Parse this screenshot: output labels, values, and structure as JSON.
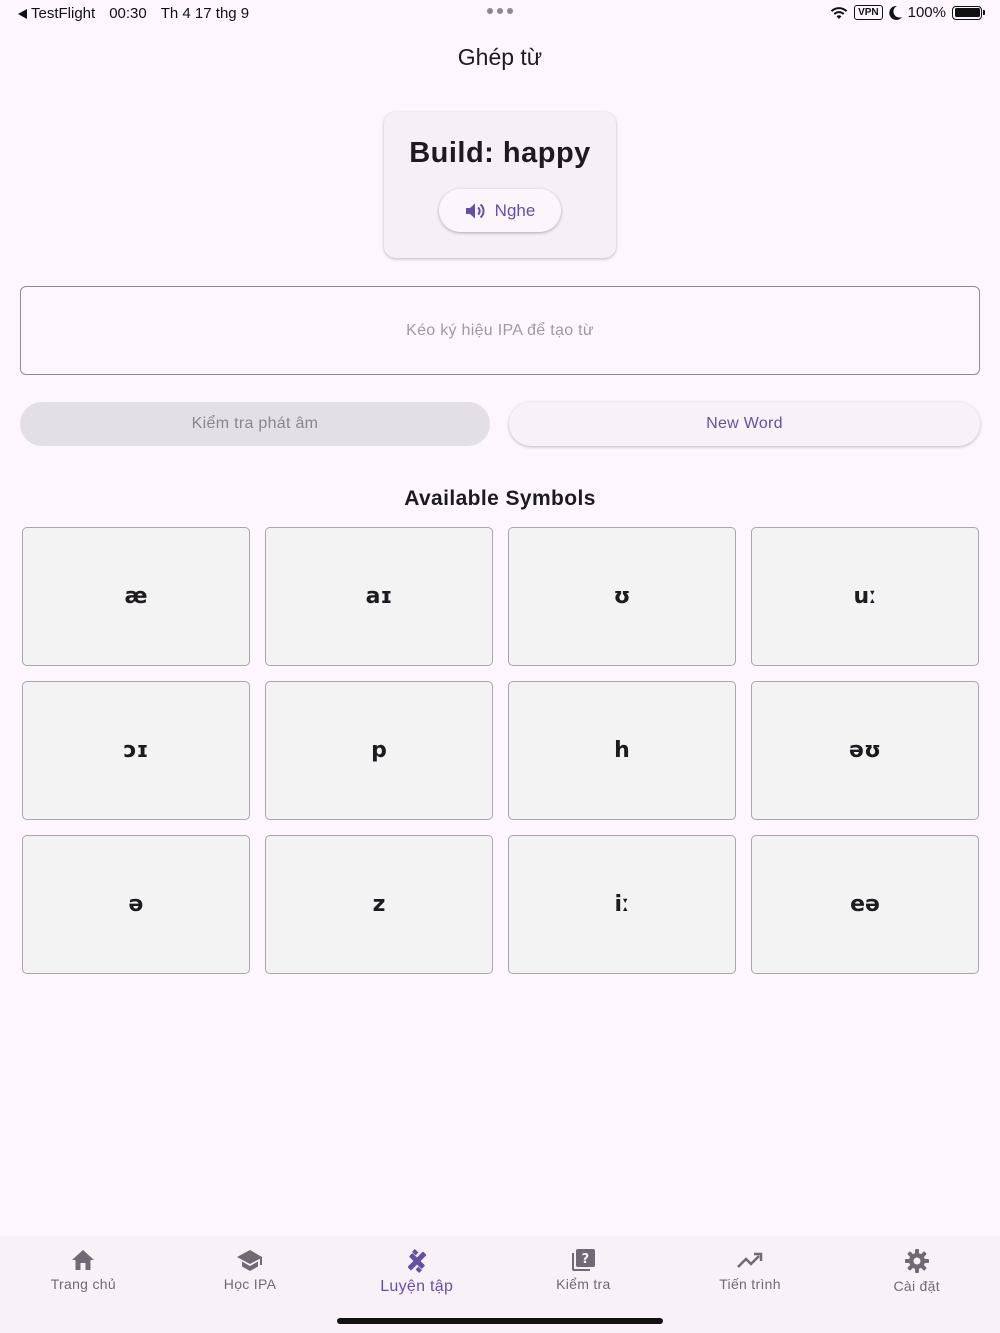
{
  "status_bar": {
    "back_app": "TestFlight",
    "time": "00:30",
    "date": "Th 4 17 thg 9",
    "vpn": "VPN",
    "battery": "100%"
  },
  "page_title": "Ghép từ",
  "card": {
    "title": "Build: happy",
    "listen_label": "Nghe"
  },
  "drop_zone": {
    "placeholder": "Kéo ký hiệu IPA để tạo từ"
  },
  "buttons": {
    "check_label": "Kiểm tra phát âm",
    "new_word_label": "New Word"
  },
  "symbols_title": "Available Symbols",
  "symbols": [
    "æ",
    "aɪ",
    "ʊ",
    "uː",
    "ɔɪ",
    "p",
    "h",
    "əʊ",
    "ə",
    "z",
    "iː",
    "eə"
  ],
  "nav": [
    {
      "label": "Trang chủ",
      "icon": "home-icon",
      "active": false
    },
    {
      "label": "Học IPA",
      "icon": "school-icon",
      "active": false
    },
    {
      "label": "Luyện tập",
      "icon": "fitness-icon",
      "active": true
    },
    {
      "label": "Kiểm tra",
      "icon": "quiz-icon",
      "active": false
    },
    {
      "label": "Tiến trình",
      "icon": "trending-up-icon",
      "active": false
    },
    {
      "label": "Cài đặt",
      "icon": "gear-icon",
      "active": false
    }
  ],
  "colors": {
    "accent": "#6750a4",
    "background": "#fdf7fd"
  }
}
